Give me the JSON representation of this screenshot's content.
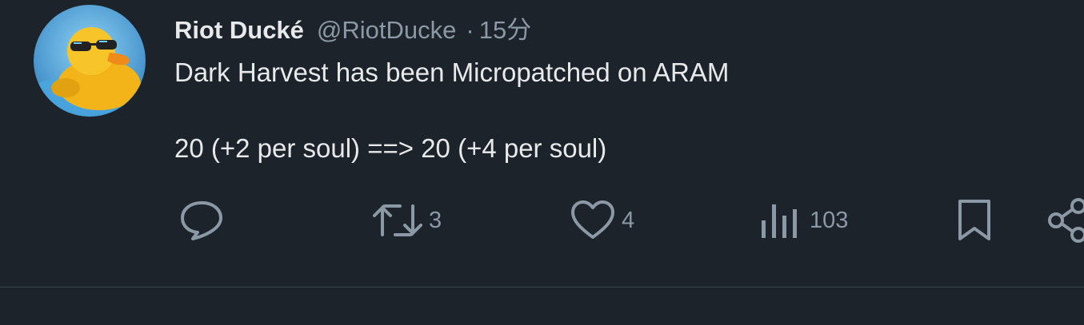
{
  "tweet": {
    "display_name": "Riot Ducké",
    "handle": "@RiotDucke",
    "separator": "·",
    "time": "15分",
    "body_line1": "Dark Harvest has been Micropatched on ARAM",
    "body_line2": "20 (+2 per soul) ==> 20 (+4 per soul)"
  },
  "actions": {
    "reply": {
      "icon": "reply-icon"
    },
    "retweet": {
      "icon": "retweet-icon",
      "count": "3"
    },
    "like": {
      "icon": "heart-icon",
      "count": "4"
    },
    "views": {
      "icon": "analytics-icon",
      "count": "103"
    },
    "bookmark": {
      "icon": "bookmark-icon"
    },
    "share": {
      "icon": "share-icon"
    }
  },
  "colors": {
    "background": "#1c232b",
    "primary_text": "#e7e9ea",
    "secondary_text": "#8b98a5",
    "divider": "#38444d"
  }
}
